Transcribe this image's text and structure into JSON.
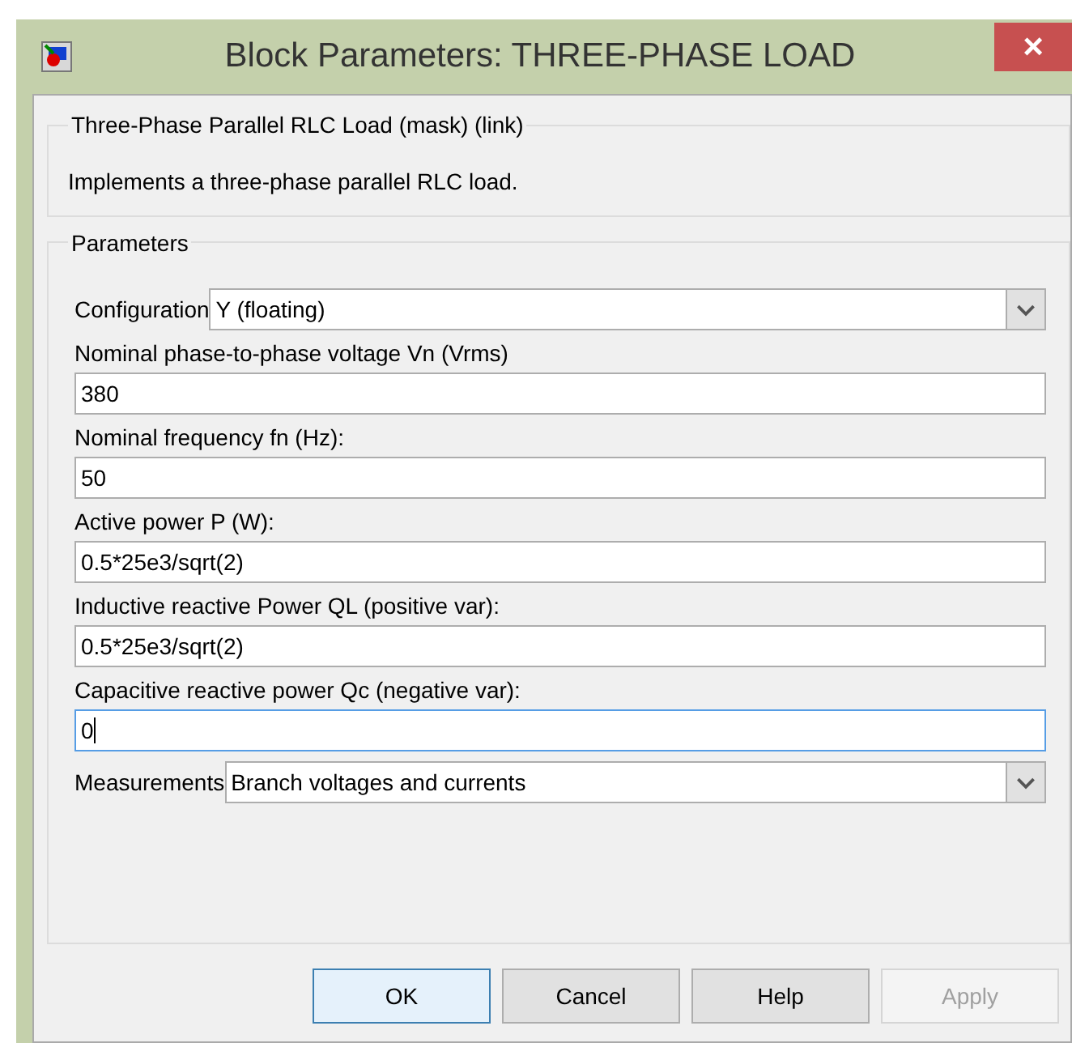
{
  "window": {
    "title": "Block Parameters: THREE-PHASE LOAD",
    "close": "×"
  },
  "description_group": {
    "title": "Three-Phase Parallel RLC Load (mask) (link)",
    "text": "Implements a three-phase parallel RLC load."
  },
  "parameters_group": {
    "title": "Parameters",
    "fields": [
      {
        "kind": "popup",
        "label": "Configuration",
        "value": "Y (floating)"
      },
      {
        "kind": "edit",
        "label": "Nominal phase-to-phase voltage Vn (Vrms)",
        "value": "380",
        "focused": false
      },
      {
        "kind": "edit",
        "label": "Nominal frequency fn (Hz):",
        "value": "50",
        "focused": false
      },
      {
        "kind": "edit",
        "label": "Active power P (W):",
        "value": "0.5*25e3/sqrt(2)",
        "focused": false
      },
      {
        "kind": "edit",
        "label": "Inductive reactive Power QL (positive var):",
        "value": "0.5*25e3/sqrt(2)",
        "focused": false
      },
      {
        "kind": "edit",
        "label": "Capacitive reactive power Qc (negative var):",
        "value": "0",
        "focused": true
      },
      {
        "kind": "popup",
        "label": "Measurements",
        "value": "Branch voltages and currents"
      }
    ]
  },
  "buttons": [
    {
      "label": "OK",
      "default": true,
      "disabled": false
    },
    {
      "label": "Cancel",
      "default": false,
      "disabled": false
    },
    {
      "label": "Help",
      "default": false,
      "disabled": false
    },
    {
      "label": "Apply",
      "default": false,
      "disabled": true
    }
  ]
}
